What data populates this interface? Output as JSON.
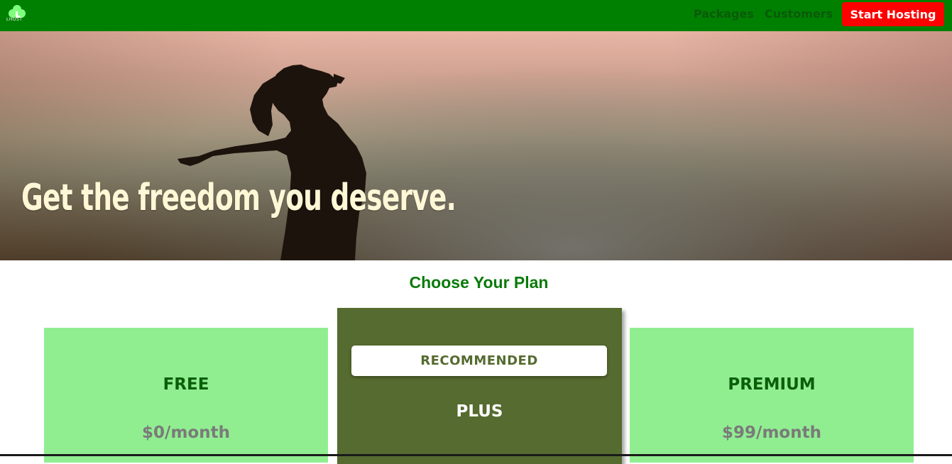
{
  "header": {
    "logo_text": "LHOST",
    "nav": [
      {
        "label": "Packages"
      },
      {
        "label": "Customers"
      }
    ],
    "cta_label": "Start Hosting"
  },
  "hero": {
    "title": "Get the freedom you deserve."
  },
  "plans_section": {
    "title": "Choose Your Plan",
    "plans": [
      {
        "name": "FREE",
        "price": "$0/month"
      },
      {
        "name": "PLUS",
        "badge": "RECOMMENDED"
      },
      {
        "name": "PREMIUM",
        "price": "$99/month"
      }
    ]
  },
  "colors": {
    "topbar": "#008000",
    "cta": "#ff0000",
    "card_light": "#90ee90",
    "card_recommended": "#556b2f",
    "section_title": "#0a7a0a",
    "hero_text": "#fff7d6"
  },
  "icons": {
    "logo": "clover-logo-icon"
  }
}
